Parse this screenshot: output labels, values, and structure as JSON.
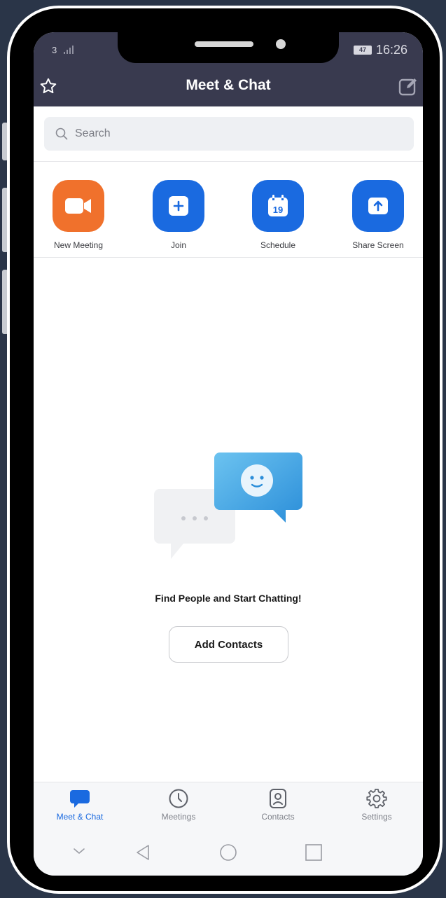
{
  "status": {
    "carrier": "3",
    "battery": "47",
    "time": "16:26"
  },
  "header": {
    "title": "Meet & Chat"
  },
  "search": {
    "placeholder": "Search"
  },
  "actions": [
    {
      "label": "New Meeting",
      "icon": "video-camera-icon",
      "color": "#f0712c"
    },
    {
      "label": "Join",
      "icon": "plus-icon",
      "color": "#1a6ae0"
    },
    {
      "label": "Schedule",
      "icon": "calendar-icon",
      "color": "#1a6ae0",
      "calendar_day": "19"
    },
    {
      "label": "Share Screen",
      "icon": "upload-arrow-icon",
      "color": "#1a6ae0"
    }
  ],
  "empty_state": {
    "message": "Find People and Start Chatting!",
    "button": "Add Contacts"
  },
  "tabs": [
    {
      "label": "Meet & Chat",
      "icon": "chat-bubble-icon",
      "active": true
    },
    {
      "label": "Meetings",
      "icon": "clock-icon",
      "active": false
    },
    {
      "label": "Contacts",
      "icon": "contact-card-icon",
      "active": false
    },
    {
      "label": "Settings",
      "icon": "gear-icon",
      "active": false
    }
  ],
  "colors": {
    "accent": "#1a6ae0",
    "header": "#393a4f",
    "orange": "#f0712c"
  }
}
